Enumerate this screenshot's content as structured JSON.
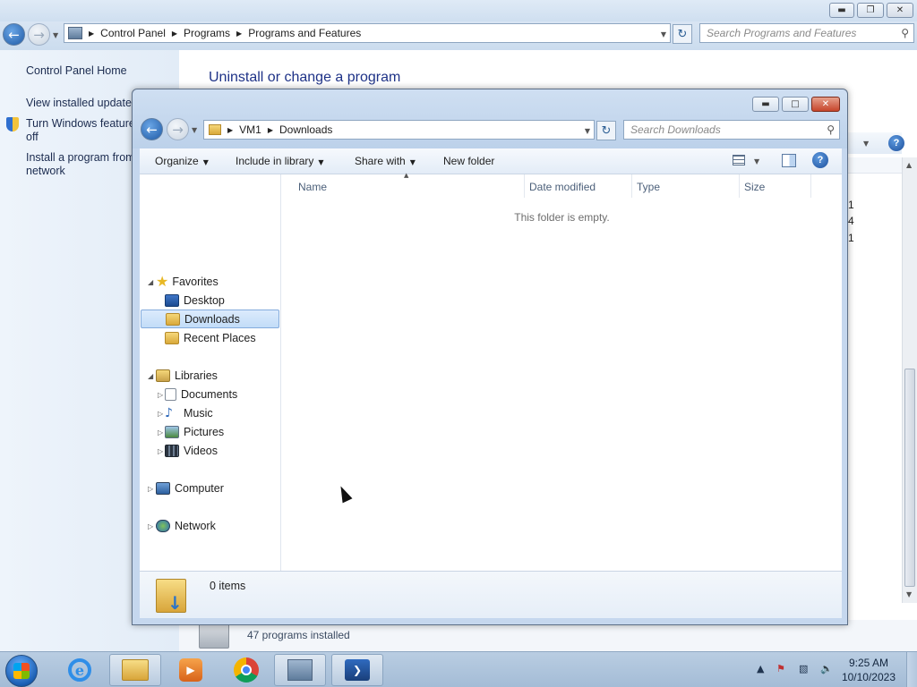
{
  "control_panel": {
    "breadcrumb": [
      "Control Panel",
      "Programs",
      "Programs and Features"
    ],
    "search_placeholder": "Search Programs and Features",
    "sidebar": {
      "home": "Control Panel Home",
      "view_updates": "View installed updates",
      "features_line1": "Turn Windows feature",
      "features_line2": "off",
      "install_line1": "Install a program from",
      "install_line2": "network"
    },
    "main_title": "Uninstall or change a program",
    "programs_installed": "47 programs installed",
    "partial_values": [
      "1",
      "4",
      "1"
    ]
  },
  "explorer": {
    "breadcrumb": [
      "VM1",
      "Downloads"
    ],
    "search_placeholder": "Search Downloads",
    "toolbar": {
      "organize": "Organize",
      "include_in_library": "Include in library",
      "share_with": "Share with",
      "new_folder": "New folder"
    },
    "nav": {
      "favorites": "Favorites",
      "desktop": "Desktop",
      "downloads": "Downloads",
      "recent_places": "Recent Places",
      "libraries": "Libraries",
      "documents": "Documents",
      "music": "Music",
      "pictures": "Pictures",
      "videos": "Videos",
      "computer": "Computer",
      "network": "Network"
    },
    "columns": {
      "name": "Name",
      "date_modified": "Date modified",
      "type": "Type",
      "size": "Size"
    },
    "empty_message": "This folder is empty.",
    "items_count": "0 items"
  },
  "taskbar": {
    "time": "9:25 AM",
    "date": "10/10/2023"
  },
  "icons": {
    "back": "back-arrow-icon",
    "forward": "forward-arrow-icon",
    "refresh": "refresh-icon",
    "search": "search-icon",
    "help": "help-icon",
    "views": "views-icon",
    "preview_pane": "preview-pane-icon"
  },
  "colors": {
    "link": "#1b2b4f",
    "title": "#1e3287",
    "selection": "#c2dcf8",
    "taskbar": "#a4bcd6"
  }
}
